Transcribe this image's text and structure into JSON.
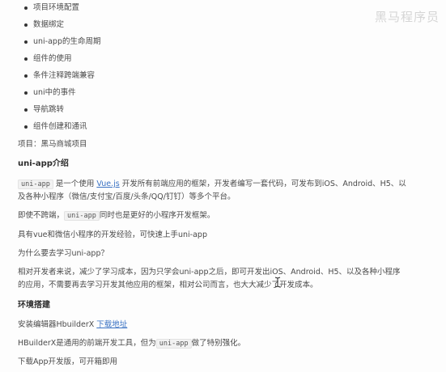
{
  "watermark": "黑马程序员",
  "bullets": [
    "项目环境配置",
    "数据绑定",
    "uni-app的生命周期",
    "组件的使用",
    "条件注释跨端兼容",
    "uni中的事件",
    "导航跳转",
    "组件创建和通讯"
  ],
  "project_line": "项目：黑马商城项目",
  "intro": {
    "heading": "uni-app介绍",
    "p1": {
      "code": "uni-app",
      "text_a": " 是一个使用 ",
      "link": "Vue.js",
      "text_b": " 开发所有前端应用的框架，开发者编写一套代码，可发布到iOS、Android、H5、以",
      "line2": "及各种小程序（微信/支付宝/百度/头条/QQ/钉钉）等多个平台。"
    },
    "p2": {
      "text_a": "即使不跨端，",
      "code": "uni-app",
      "text_b": "同时也是更好的小程序开发框架。"
    },
    "p3": "具有vue和微信小程序的开发经验，可快速上手uni-app",
    "p4": "为什么要去学习uni-app？",
    "p5_line1": "相对开发者来说，减少了学习成本，因为只学会uni-app之后，即可开发出iOS、Android、H5、以及各种小程序",
    "p5_line2": "的应用，不需要再去学习开发其他应用的框架，相对公司而言，也大大减少了开发成本。"
  },
  "env": {
    "heading": "环境搭建",
    "install_text": "安装编辑器HbuilderX ",
    "install_link": "下载地址",
    "hb_text_a": "HBuilderX是通用的前端开发工具，但为",
    "hb_code": "uni-app",
    "hb_text_b": "做了特别强化。",
    "download_app": "下载App开发版，可开箱即用"
  }
}
